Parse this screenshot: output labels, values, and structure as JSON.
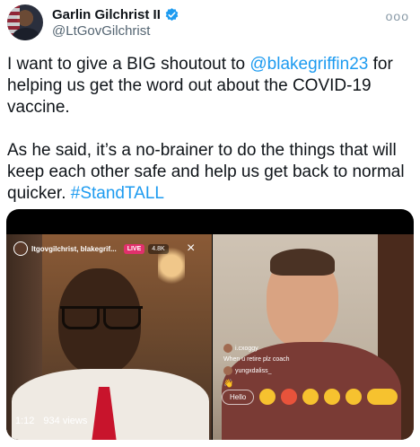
{
  "author": {
    "display_name": "Garlin Gilchrist II",
    "handle": "@LtGovGilchrist",
    "verified": true
  },
  "menu": {
    "icon": "more-horizontal-icon",
    "label": "ooo"
  },
  "tweet": {
    "p1_before": "I want to give a BIG shoutout to ",
    "p1_mention": "@blakegriffin23",
    "p1_after": " for helping us get the word out about the COVID-19 vaccine.",
    "p2_before": "As he said, it’s a no-brainer to do the things that will keep each other safe and help us get back to normal quicker. ",
    "p2_hashtag": "#StandTALL"
  },
  "video": {
    "ig_username": "ltgovgilchrist, blakegrif...",
    "live_label": "LIVE",
    "viewer_count": "4.8K",
    "comments": [
      {
        "user": "i.cxoggy",
        "text": "When u retire plz coach"
      },
      {
        "user": "yungxdaliss_",
        "text": "👋"
      }
    ],
    "hello_label": "Hello",
    "time": "1:12",
    "views": "934 views"
  },
  "colors": {
    "link": "#1d9bf0",
    "verified": "#1d9bf0",
    "live": "#e1306c"
  }
}
